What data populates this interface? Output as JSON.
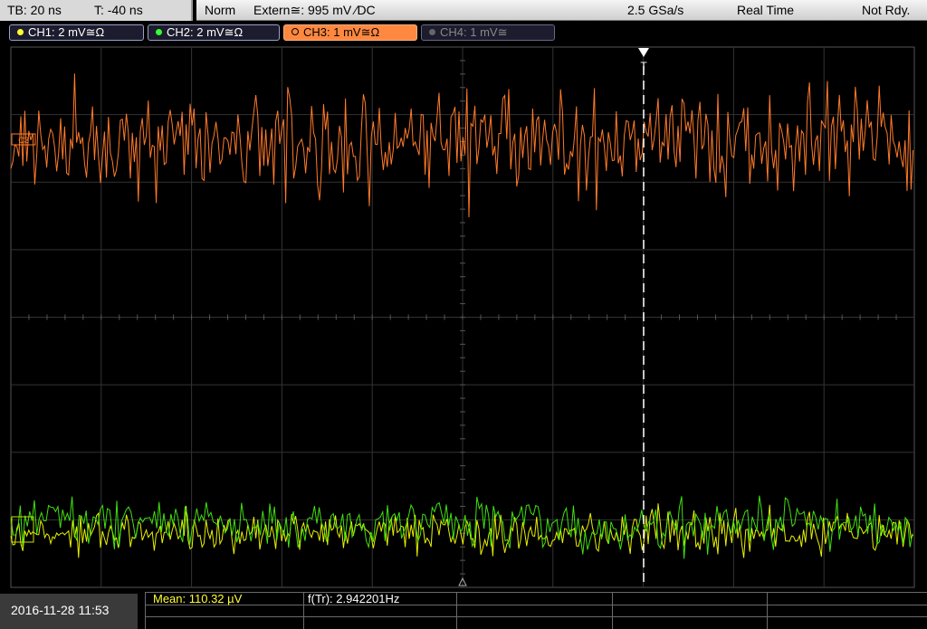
{
  "timebase": {
    "tb": "TB: 20 ns",
    "t": "T: -40 ns"
  },
  "status": {
    "mode": "Norm",
    "trigger": "Extern≅: 995 mV ∕DC",
    "sample_rate": "2.5 GSa/s",
    "acq": "Real Time",
    "ready": "Not Rdy."
  },
  "channels": [
    {
      "label": "CH1: 2 mV≅Ω",
      "color": "#ffff33"
    },
    {
      "label": "CH2: 2 mV≅Ω",
      "color": "#33ff33"
    },
    {
      "label": "CH3: 1 mV≅Ω",
      "color": "#ff8840"
    },
    {
      "label": "CH4: 1 mV≅",
      "color": "#888888"
    }
  ],
  "trace_colors": {
    "ch1": "#e8f000",
    "ch2": "#40e010",
    "ch3": "#ff7a2a"
  },
  "ch3_marker": "C3",
  "datetime": "2016-11-28 11:53",
  "measurements": {
    "mean": "Mean: 110.32 µV",
    "freq": "f(Tr): 2.942201Hz"
  }
}
